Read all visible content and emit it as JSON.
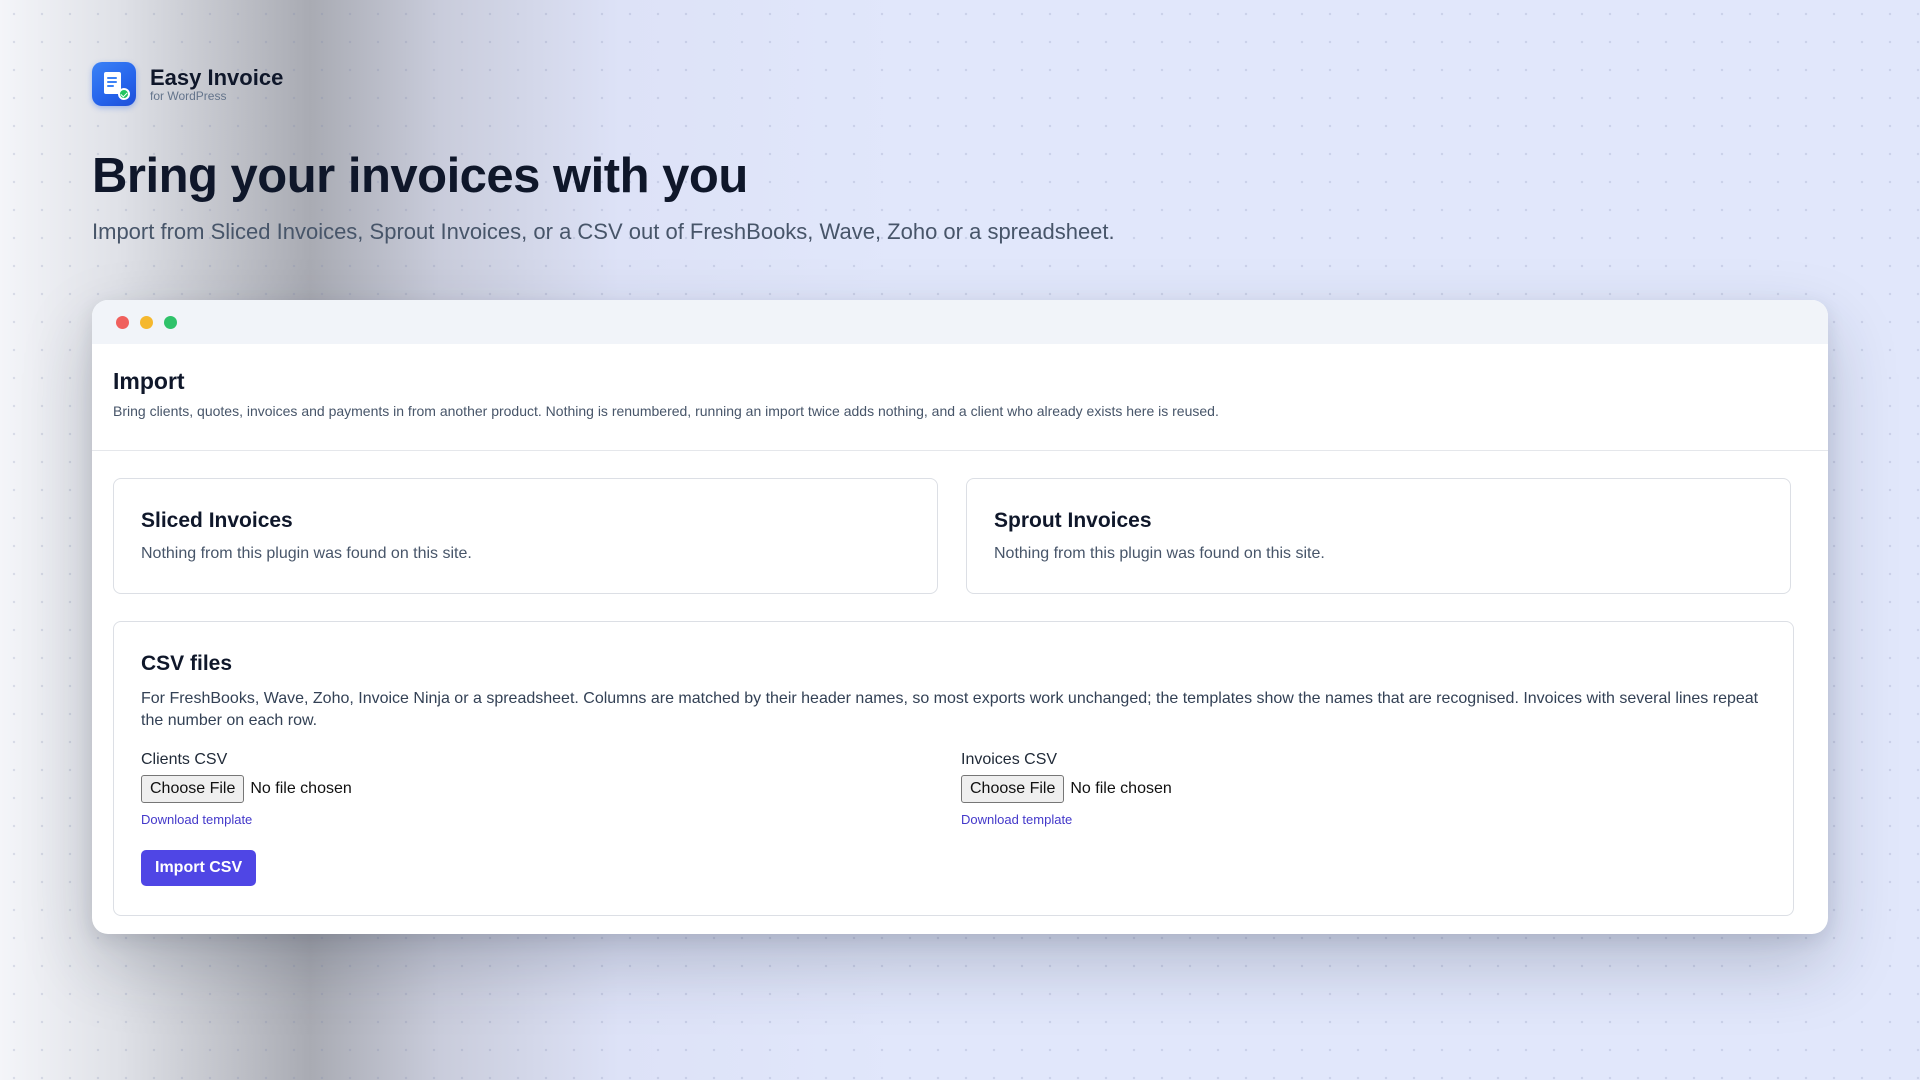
{
  "brand": {
    "name": "Easy Invoice",
    "sub": "for WordPress",
    "logo_icon": "invoice-document-check-icon"
  },
  "hero": {
    "title": "Bring your invoices with you",
    "subtitle": "Import from Sliced Invoices, Sprout Invoices, or a CSV out of FreshBooks, Wave, Zoho or a spreadsheet."
  },
  "window": {
    "controls": [
      "close",
      "minimize",
      "maximize"
    ]
  },
  "page": {
    "title": "Import",
    "description": "Bring clients, quotes, invoices and payments in from another product. Nothing is renumbered, running an import twice adds nothing, and a client who already exists here is reused."
  },
  "sources": [
    {
      "title": "Sliced Invoices",
      "status": "Nothing from this plugin was found on this site."
    },
    {
      "title": "Sprout Invoices",
      "status": "Nothing from this plugin was found on this site."
    }
  ],
  "csv": {
    "title": "CSV files",
    "description": "For FreshBooks, Wave, Zoho, Invoice Ninja or a spreadsheet. Columns are matched by their header names, so most exports work unchanged; the templates show the names that are recognised. Invoices with several lines repeat the number on each row.",
    "fields": [
      {
        "label": "Clients CSV",
        "button": "Choose File",
        "status": "No file chosen",
        "link": "Download template"
      },
      {
        "label": "Invoices CSV",
        "button": "Choose File",
        "status": "No file chosen",
        "link": "Download template"
      }
    ],
    "submit": "Import CSV"
  },
  "colors": {
    "accent": "#4f46e5",
    "link": "#4338ca",
    "brand_blue": "#2563eb",
    "background": "#e1e7fb"
  }
}
